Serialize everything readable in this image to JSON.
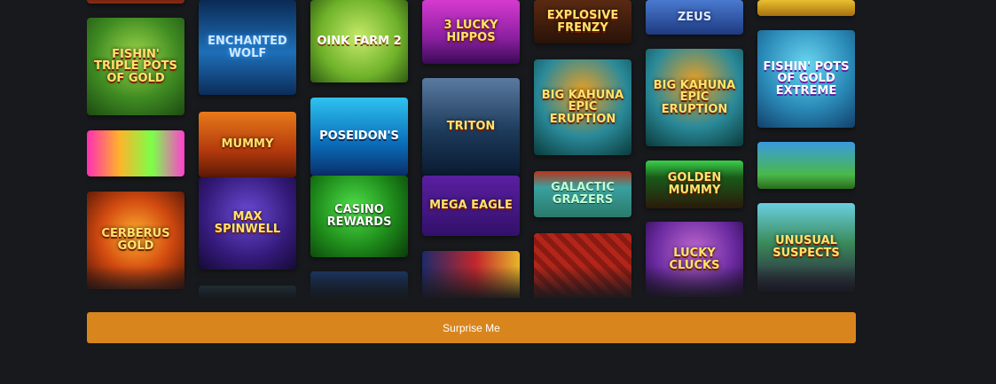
{
  "tiles": [
    {
      "id": "t-c1-top",
      "title": ""
    },
    {
      "id": "fishin-triple-pots",
      "title": "Fishin' Triple Pots of Gold"
    },
    {
      "id": "gold-chest",
      "title": ""
    },
    {
      "id": "cerberus-gold",
      "title": "Cerberus Gold"
    },
    {
      "id": "enchanted-wolf",
      "title": "Enchanted Wolf"
    },
    {
      "id": "mummy",
      "title": "Mummy"
    },
    {
      "id": "max-spinwell",
      "title": "Max Spinwell"
    },
    {
      "id": "t-c2-bottom",
      "title": ""
    },
    {
      "id": "oink-farm-2",
      "title": "Oink Farm 2"
    },
    {
      "id": "poseidons",
      "title": "Poseidon's"
    },
    {
      "id": "casino-rewards",
      "title": "Casino Rewards"
    },
    {
      "id": "t-c3-bottom",
      "title": ""
    },
    {
      "id": "lucky-hippos",
      "title": "3 Lucky Hippos"
    },
    {
      "id": "triton",
      "title": "Triton"
    },
    {
      "id": "mega-eagle",
      "title": "Mega Eagle"
    },
    {
      "id": "t-c4-bottom",
      "title": ""
    },
    {
      "id": "explosive-frenzy",
      "title": "Explosive Frenzy"
    },
    {
      "id": "big-kahuna-epic-1",
      "title": "Big Kahuna Epic Eruption"
    },
    {
      "id": "galactic-grazers",
      "title": "Galactic Grazers"
    },
    {
      "id": "t-c5-bottom",
      "title": ""
    },
    {
      "id": "zeus",
      "title": "Zeus"
    },
    {
      "id": "big-kahuna-epic-2",
      "title": "Big Kahuna Epic Eruption"
    },
    {
      "id": "golden-mummy",
      "title": "Golden Mummy"
    },
    {
      "id": "lucky-clucks",
      "title": "Lucky Clucks"
    },
    {
      "id": "t-c7-top",
      "title": ""
    },
    {
      "id": "fishin-pots-extreme",
      "title": "Fishin' Pots of Gold Extreme"
    },
    {
      "id": "viking-landscape",
      "title": ""
    },
    {
      "id": "unusual-suspects",
      "title": "Unusual Suspects"
    }
  ],
  "colors": {
    "background": "#17191c",
    "accent": "#d9851e"
  },
  "surprise_button": {
    "label": "Surprise Me"
  }
}
